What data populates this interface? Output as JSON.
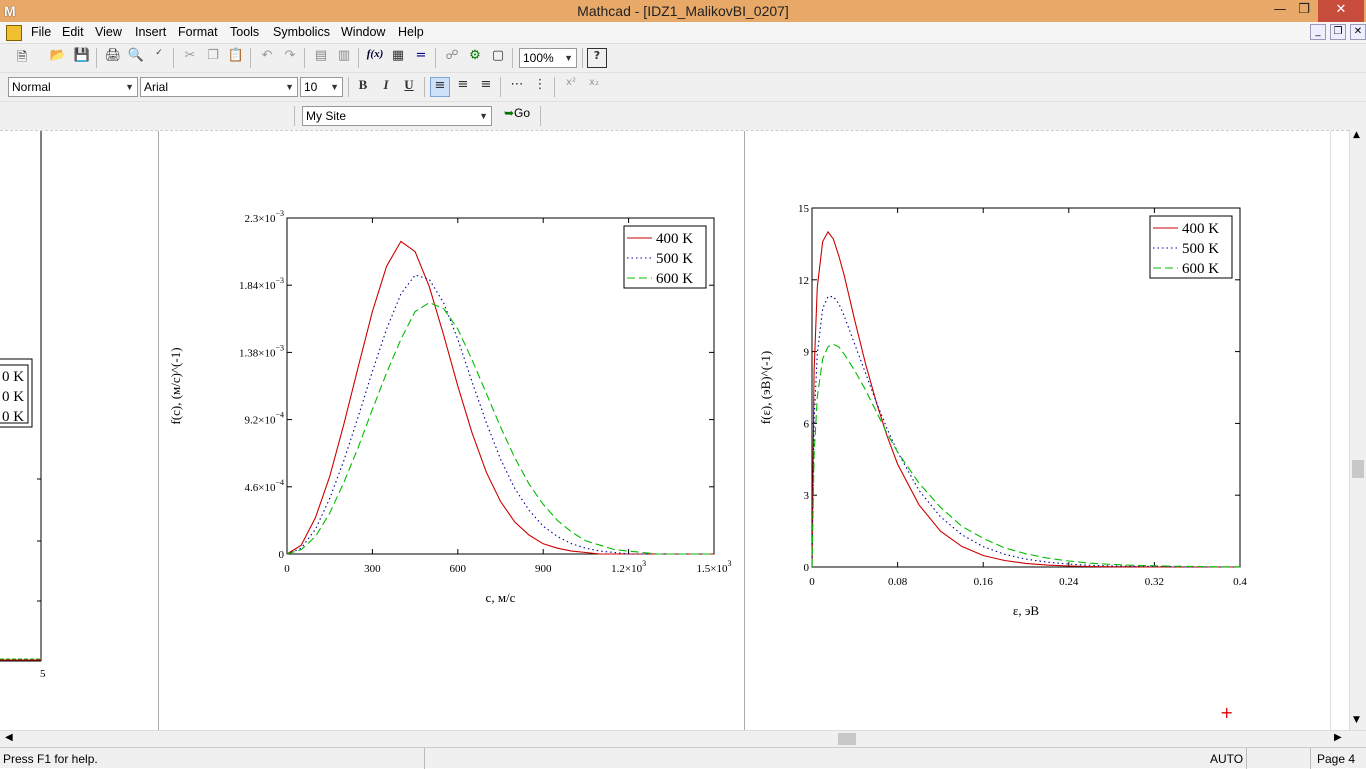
{
  "window": {
    "title": "Mathcad - [IDZ1_MalikovBI_0207]",
    "app_icon": "M"
  },
  "menu": {
    "items": [
      "File",
      "Edit",
      "View",
      "Insert",
      "Format",
      "Tools",
      "Symbolics",
      "Window",
      "Help"
    ]
  },
  "toolbar": {
    "zoom": "100%"
  },
  "format_bar": {
    "style": "Normal",
    "font": "Arial",
    "size": "10",
    "bold": "B",
    "italic": "I",
    "underline": "U"
  },
  "resource_bar": {
    "site": "My Site",
    "go_label": "Go"
  },
  "plot_left_partial": {
    "legend": [
      "0 K",
      "0 K",
      "0 K"
    ],
    "x_tick": "5"
  },
  "plot1": {
    "ylabel": "f(c), (м/с)^(-1)",
    "xlabel": "c, м/с",
    "y_ticks": [
      {
        "m": "2.3×10",
        "e": "−3"
      },
      {
        "m": "1.84×10",
        "e": "−3"
      },
      {
        "m": "1.38×10",
        "e": "−3"
      },
      {
        "m": "9.2×10",
        "e": "−4"
      },
      {
        "m": "4.6×10",
        "e": "−4"
      },
      {
        "m": "0",
        "e": ""
      }
    ],
    "x_ticks": [
      {
        "m": "0",
        "e": ""
      },
      {
        "m": "300",
        "e": ""
      },
      {
        "m": "600",
        "e": ""
      },
      {
        "m": "900",
        "e": ""
      },
      {
        "m": "1.2×10",
        "e": "3"
      },
      {
        "m": "1.5×10",
        "e": "3"
      }
    ],
    "legend": [
      "400 K",
      "500 K",
      "600 K"
    ]
  },
  "plot2": {
    "ylabel": "f(ε), (эВ)^(-1)",
    "xlabel": "ε, эВ",
    "y_ticks": [
      "15",
      "12",
      "9",
      "6",
      "3",
      "0"
    ],
    "x_ticks": [
      "0",
      "0.08",
      "0.16",
      "0.24",
      "0.32",
      "0.4"
    ],
    "legend": [
      "400 K",
      "500 K",
      "600 K"
    ]
  },
  "chart_data": [
    {
      "type": "line",
      "xlabel": "c, м/с",
      "ylabel": "f(c), (м/с)^(-1)",
      "xlim": [
        0,
        1500
      ],
      "ylim": [
        0,
        0.0023
      ],
      "x": [
        0,
        50,
        100,
        150,
        200,
        250,
        300,
        350,
        400,
        450,
        500,
        550,
        600,
        650,
        700,
        750,
        800,
        850,
        900,
        950,
        1000,
        1050,
        1100,
        1150,
        1200,
        1250,
        1300,
        1350,
        1400,
        1450,
        1500
      ],
      "series": [
        {
          "name": "400 K",
          "color": "#cc0000",
          "dash": "solid",
          "values": [
            0,
            6e-05,
            0.00025,
            0.00053,
            0.00089,
            0.00128,
            0.00166,
            0.00197,
            0.00214,
            0.00207,
            0.00183,
            0.0015,
            0.00115,
            0.00083,
            0.00056,
            0.00036,
            0.00022,
            0.00013,
            7e-05,
            4e-05,
            2e-05,
            1e-05,
            0,
            0,
            0,
            0,
            0,
            0,
            0,
            0,
            0
          ]
        },
        {
          "name": "500 K",
          "color": "#000099",
          "dash": "dotted",
          "values": [
            0,
            4e-05,
            0.00017,
            0.00038,
            0.00064,
            0.00094,
            0.00125,
            0.00154,
            0.00178,
            0.00191,
            0.00188,
            0.00172,
            0.00147,
            0.00118,
            0.0009,
            0.00065,
            0.00045,
            0.0003,
            0.00019,
            0.00012,
            7e-05,
            4e-05,
            2e-05,
            1e-05,
            0,
            0,
            0,
            0,
            0,
            0,
            0
          ]
        },
        {
          "name": "600 K",
          "color": "#00bb00",
          "dash": "dashed",
          "values": [
            0,
            3e-05,
            0.00012,
            0.00028,
            0.00049,
            0.00073,
            0.00099,
            0.00124,
            0.00147,
            0.00166,
            0.00172,
            0.00168,
            0.00154,
            0.00133,
            0.0011,
            0.00087,
            0.00066,
            0.00048,
            0.00034,
            0.00023,
            0.00015,
            9e-05,
            6e-05,
            3e-05,
            2e-05,
            1e-05,
            0,
            0,
            0,
            0,
            0
          ]
        }
      ],
      "legend_position": "top-right",
      "grid": false
    },
    {
      "type": "line",
      "xlabel": "ε, эВ",
      "ylabel": "f(ε), (эВ)^(-1)",
      "xlim": [
        0,
        0.4
      ],
      "ylim": [
        0,
        15
      ],
      "x": [
        0,
        0.002,
        0.005,
        0.01,
        0.015,
        0.02,
        0.025,
        0.03,
        0.04,
        0.05,
        0.06,
        0.07,
        0.08,
        0.1,
        0.12,
        0.14,
        0.16,
        0.18,
        0.2,
        0.22,
        0.24,
        0.26,
        0.28,
        0.3,
        0.32,
        0.34,
        0.36,
        0.38,
        0.4
      ],
      "series": [
        {
          "name": "400 K",
          "color": "#cc0000",
          "dash": "solid",
          "values": [
            0,
            8.2,
            11.7,
            13.6,
            14.0,
            13.7,
            13.0,
            12.2,
            10.3,
            8.5,
            6.9,
            5.5,
            4.3,
            2.6,
            1.5,
            0.86,
            0.48,
            0.27,
            0.15,
            0.08,
            0.04,
            0.02,
            0.01,
            0.01,
            0,
            0,
            0,
            0,
            0
          ]
        },
        {
          "name": "500 K",
          "color": "#000099",
          "dash": "dotted",
          "values": [
            0,
            6.1,
            8.9,
            10.8,
            11.3,
            11.3,
            11.0,
            10.5,
            9.3,
            8.1,
            6.9,
            5.8,
            4.8,
            3.2,
            2.1,
            1.35,
            0.85,
            0.53,
            0.33,
            0.2,
            0.12,
            0.07,
            0.04,
            0.03,
            0.02,
            0.01,
            0,
            0,
            0
          ]
        },
        {
          "name": "600 K",
          "color": "#00bb00",
          "dash": "dashed",
          "values": [
            0,
            4.7,
            7.1,
            8.7,
            9.2,
            9.3,
            9.2,
            8.9,
            8.2,
            7.4,
            6.5,
            5.6,
            4.8,
            3.5,
            2.5,
            1.7,
            1.2,
            0.8,
            0.55,
            0.37,
            0.25,
            0.16,
            0.11,
            0.07,
            0.05,
            0.03,
            0.02,
            0.01,
            0.01
          ]
        }
      ],
      "legend_position": "top-right",
      "grid": false
    }
  ],
  "status": {
    "help": "Press F1 for help.",
    "mode": "AUTO",
    "page": "Page 4"
  }
}
